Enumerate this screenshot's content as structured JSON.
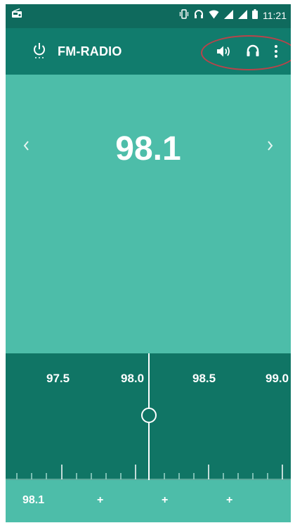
{
  "status_bar": {
    "time": "11:21"
  },
  "app_bar": {
    "title": "FM-RADIO"
  },
  "frequency": {
    "current": "98.1"
  },
  "dial": {
    "scale_labels": [
      "97.5",
      "98.0",
      "98.5",
      "99.0"
    ]
  },
  "presets": {
    "items": [
      "98.1",
      "+",
      "+",
      "+"
    ]
  },
  "icons": {
    "status": [
      "radio-icon",
      "vibrate-icon",
      "headset-icon",
      "wifi-icon",
      "signal-icon",
      "signal-icon",
      "battery-icon"
    ],
    "app_bar": [
      "power-icon",
      "speaker-icon",
      "headphones-icon",
      "more-vert-icon"
    ],
    "nav": [
      "chevron-left-icon",
      "chevron-right-icon"
    ]
  },
  "colors": {
    "status_bar": "#0f6a5d",
    "app_bar": "#117c6d",
    "main": "#4dbda9",
    "dial": "#107565",
    "annotation_ring": "#b9434a"
  }
}
